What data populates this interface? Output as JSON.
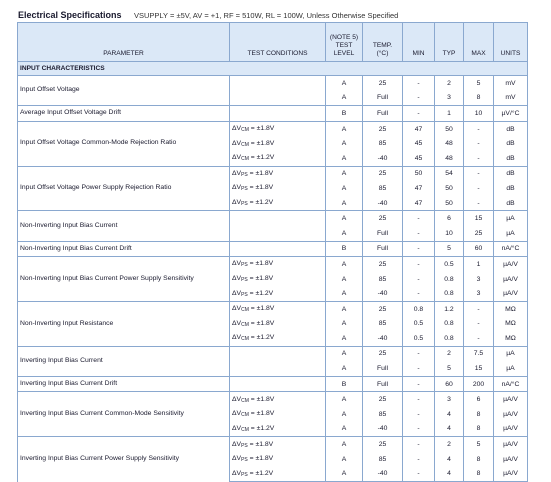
{
  "title": "Electrical Specifications",
  "conditions": "VSUPPLY = ±5V, AV = +1, RF = 510W, RL = 100W, Unless Otherwise Specified",
  "headers": {
    "parameter": "PARAMETER",
    "test_conditions": "TEST CONDITIONS",
    "level": [
      "(NOTE 5)",
      "TEST",
      "LEVEL"
    ],
    "temp": [
      "TEMP.",
      "(°C)"
    ],
    "min": "MIN",
    "typ": "TYP",
    "max": "MAX",
    "units": "UNITS"
  },
  "section": "INPUT CHARACTERISTICS",
  "rows": [
    {
      "param": "Input Offset Voltage",
      "cond": "",
      "level": "A",
      "temp": "25",
      "min": "-",
      "typ": "2",
      "max": "5",
      "units": "mV"
    },
    {
      "param": "",
      "cond": "",
      "level": "A",
      "temp": "Full",
      "min": "-",
      "typ": "3",
      "max": "8",
      "units": "mV"
    },
    {
      "param": "Average Input Offset Voltage Drift",
      "cond": "",
      "level": "B",
      "temp": "Full",
      "min": "-",
      "typ": "1",
      "max": "10",
      "units": "µV/°C"
    },
    {
      "param": "Input Offset Voltage Common-Mode Rejection Ratio",
      "cond": "ΔVCM = ±1.8V",
      "level": "A",
      "temp": "25",
      "min": "47",
      "typ": "50",
      "max": "-",
      "units": "dB"
    },
    {
      "param": "",
      "cond": "ΔVCM = ±1.8V",
      "level": "A",
      "temp": "85",
      "min": "45",
      "typ": "48",
      "max": "-",
      "units": "dB"
    },
    {
      "param": "",
      "cond": "ΔVCM = ±1.2V",
      "level": "A",
      "temp": "-40",
      "min": "45",
      "typ": "48",
      "max": "-",
      "units": "dB"
    },
    {
      "param": "Input Offset Voltage Power Supply Rejection Ratio",
      "cond": "ΔVPS = ±1.8V",
      "level": "A",
      "temp": "25",
      "min": "50",
      "typ": "54",
      "max": "-",
      "units": "dB"
    },
    {
      "param": "",
      "cond": "ΔVPS = ±1.8V",
      "level": "A",
      "temp": "85",
      "min": "47",
      "typ": "50",
      "max": "-",
      "units": "dB"
    },
    {
      "param": "",
      "cond": "ΔVPS = ±1.2V",
      "level": "A",
      "temp": "-40",
      "min": "47",
      "typ": "50",
      "max": "-",
      "units": "dB"
    },
    {
      "param": "Non-Inverting Input Bias Current",
      "cond": "",
      "level": "A",
      "temp": "25",
      "min": "-",
      "typ": "6",
      "max": "15",
      "units": "µA"
    },
    {
      "param": "",
      "cond": "",
      "level": "A",
      "temp": "Full",
      "min": "-",
      "typ": "10",
      "max": "25",
      "units": "µA"
    },
    {
      "param": "Non-Inverting Input Bias Current Drift",
      "cond": "",
      "level": "B",
      "temp": "Full",
      "min": "-",
      "typ": "5",
      "max": "60",
      "units": "nA/°C"
    },
    {
      "param": "Non-Inverting Input Bias Current Power Supply Sensitivity",
      "cond": "ΔVPS = ±1.8V",
      "level": "A",
      "temp": "25",
      "min": "-",
      "typ": "0.5",
      "max": "1",
      "units": "µA/V"
    },
    {
      "param": "",
      "cond": "ΔVPS = ±1.8V",
      "level": "A",
      "temp": "85",
      "min": "-",
      "typ": "0.8",
      "max": "3",
      "units": "µA/V"
    },
    {
      "param": "",
      "cond": "ΔVPS = ±1.2V",
      "level": "A",
      "temp": "-40",
      "min": "-",
      "typ": "0.8",
      "max": "3",
      "units": "µA/V"
    },
    {
      "param": "Non-Inverting Input Resistance",
      "cond": "ΔVCM = ±1.8V",
      "level": "A",
      "temp": "25",
      "min": "0.8",
      "typ": "1.2",
      "max": "-",
      "units": "MΩ"
    },
    {
      "param": "",
      "cond": "ΔVCM = ±1.8V",
      "level": "A",
      "temp": "85",
      "min": "0.5",
      "typ": "0.8",
      "max": "-",
      "units": "MΩ"
    },
    {
      "param": "",
      "cond": "ΔVCM = ±1.2V",
      "level": "A",
      "temp": "-40",
      "min": "0.5",
      "typ": "0.8",
      "max": "-",
      "units": "MΩ"
    },
    {
      "param": "Inverting Input Bias Current",
      "cond": "",
      "level": "A",
      "temp": "25",
      "min": "-",
      "typ": "2",
      "max": "7.5",
      "units": "µA"
    },
    {
      "param": "",
      "cond": "",
      "level": "A",
      "temp": "Full",
      "min": "-",
      "typ": "5",
      "max": "15",
      "units": "µA"
    },
    {
      "param": "Inverting Input Bias Current Drift",
      "cond": "",
      "level": "B",
      "temp": "Full",
      "min": "-",
      "typ": "60",
      "max": "200",
      "units": "nA/°C"
    },
    {
      "param": "Inverting Input Bias Current Common-Mode Sensitivity",
      "cond": "ΔVCM = ±1.8V",
      "level": "A",
      "temp": "25",
      "min": "-",
      "typ": "3",
      "max": "6",
      "units": "µA/V"
    },
    {
      "param": "",
      "cond": "ΔVCM = ±1.8V",
      "level": "A",
      "temp": "85",
      "min": "-",
      "typ": "4",
      "max": "8",
      "units": "µA/V"
    },
    {
      "param": "",
      "cond": "ΔVCM = ±1.2V",
      "level": "A",
      "temp": "-40",
      "min": "-",
      "typ": "4",
      "max": "8",
      "units": "µA/V"
    },
    {
      "param": "Inverting Input Bias Current Power Supply Sensitivity",
      "cond": "ΔVPS = ±1.8V",
      "level": "A",
      "temp": "25",
      "min": "-",
      "typ": "2",
      "max": "5",
      "units": "µA/V"
    },
    {
      "param": "",
      "cond": "ΔVPS = ±1.8V",
      "level": "A",
      "temp": "85",
      "min": "-",
      "typ": "4",
      "max": "8",
      "units": "µA/V"
    },
    {
      "param": "",
      "cond": "ΔVPS = ±1.2V",
      "level": "A",
      "temp": "-40",
      "min": "-",
      "typ": "4",
      "max": "8",
      "units": "µA/V"
    }
  ]
}
